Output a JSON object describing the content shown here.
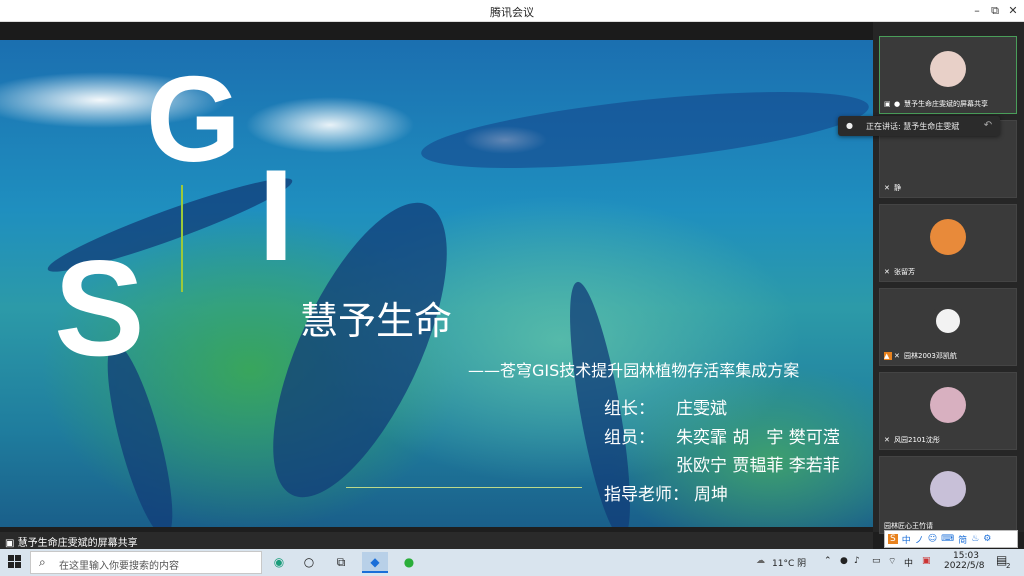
{
  "window": {
    "title": "腾讯会议",
    "min": "–",
    "max": "⧉",
    "close": "✕"
  },
  "slide": {
    "letters": [
      "G",
      "I",
      "S"
    ],
    "title": "慧予生命",
    "subtitle": "——苍穹GIS技术提升园林植物存活率集成方案",
    "leader_label": "组长：",
    "leader": "庄雯斌",
    "members_label": "组员：",
    "members_line1": "朱奕霏 胡　宇 樊可滢",
    "members_line2": "张欧宁 贾韫菲 李若菲",
    "advisor_label": "指导老师：",
    "advisor": "周坤"
  },
  "participants": [
    {
      "name": "慧予生命庄雯斌的屏幕共享",
      "avatar_color": "#e8d0c8"
    },
    {
      "name": "静",
      "avatar_color": ""
    },
    {
      "name": "张留芳",
      "avatar_color": "#e88a3a"
    },
    {
      "name": "园林2003邓凯航",
      "avatar_color": "#3a3a3a"
    },
    {
      "name": "风园2101沈彤",
      "avatar_color": "#d8b0c0"
    },
    {
      "name": "园林匠心王竹请",
      "avatar_color": "#c8c0d8"
    }
  ],
  "speaking": {
    "text": "正在讲话: 慧予生命庄雯斌"
  },
  "share_label": "慧予生命庄雯斌的屏幕共享",
  "ime": {
    "items": [
      "中",
      "ノ",
      "☺",
      "⌨",
      "简",
      "♨",
      "⚙"
    ]
  },
  "taskbar": {
    "search_placeholder": "在这里输入你要搜索的内容",
    "weather": "11°C 阴",
    "lang": "中",
    "time": "15:03",
    "date": "2022/5/8",
    "notifications": "2"
  }
}
